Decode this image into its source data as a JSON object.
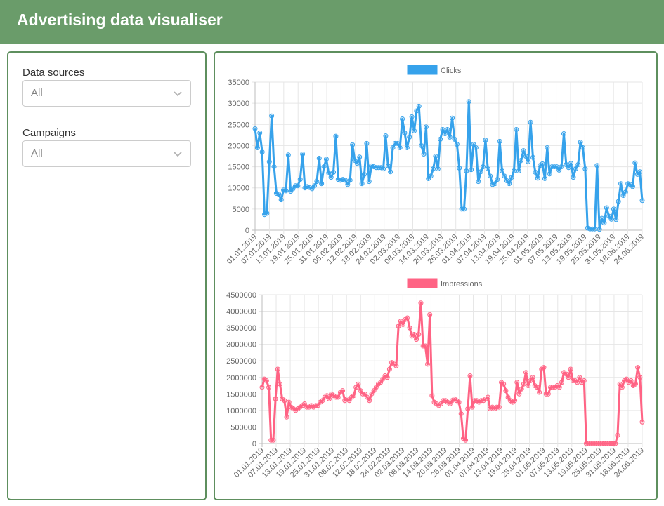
{
  "header": {
    "title": "Advertising data visualiser"
  },
  "filters": {
    "data_sources": {
      "label": "Data sources",
      "value": "All"
    },
    "campaigns": {
      "label": "Campaigns",
      "value": "All"
    }
  },
  "colors": {
    "header": "#6a9c6a",
    "clicks": "#36a2eb",
    "impressions": "#ff6384"
  },
  "chart_data": [
    {
      "type": "line",
      "series": [
        {
          "name": "Clicks",
          "color": "#36a2eb"
        }
      ],
      "xticks": [
        "01.01.2019",
        "07.01.2019",
        "13.01.2019",
        "19.01.2019",
        "25.01.2019",
        "31.01.2019",
        "06.02.2019",
        "12.02.2019",
        "18.02.2019",
        "24.02.2019",
        "02.03.2019",
        "08.03.2019",
        "14.03.2019",
        "20.03.2019",
        "26.03.2019",
        "01.04.2019",
        "07.04.2019",
        "13.04.2019",
        "19.04.2019",
        "25.04.2019",
        "01.05.2019",
        "07.05.2019",
        "13.05.2019",
        "19.05.2019",
        "25.05.2019",
        "31.05.2019",
        "18.06.2019",
        "24.06.2019"
      ],
      "yticks": [
        "0",
        "5000",
        "10000",
        "15000",
        "20000",
        "25000",
        "30000",
        "35000"
      ],
      "ylim": [
        0,
        35000
      ],
      "grid": true,
      "legend": "top",
      "values": [
        24000,
        19500,
        23000,
        18500,
        3700,
        4000,
        16200,
        27000,
        15000,
        8700,
        8500,
        7200,
        9500,
        9300,
        17800,
        9200,
        9800,
        10500,
        10500,
        12000,
        18000,
        10000,
        10300,
        10100,
        9800,
        10500,
        11500,
        17000,
        11000,
        15000,
        16800,
        13500,
        12500,
        13700,
        22200,
        12000,
        11800,
        12000,
        11800,
        10800,
        11800,
        20200,
        16500,
        15800,
        17300,
        11000,
        13200,
        20500,
        11500,
        15200,
        15000,
        14800,
        14800,
        14800,
        14500,
        22300,
        15200,
        13800,
        19500,
        20500,
        20500,
        19500,
        26300,
        23000,
        19500,
        22000,
        26800,
        23500,
        28200,
        29300,
        20000,
        18000,
        24400,
        12200,
        12800,
        14500,
        17500,
        14500,
        21500,
        23800,
        22800,
        23800,
        22000,
        26500,
        21500,
        20300,
        14700,
        5000,
        5000,
        14000,
        30400,
        14300,
        20300,
        19500,
        11500,
        13800,
        15000,
        21300,
        14500,
        12800,
        10800,
        11000,
        12000,
        21000,
        14000,
        12800,
        11700,
        11000,
        12500,
        14000,
        23800,
        14000,
        16500,
        18800,
        17500,
        16200,
        25500,
        17200,
        13700,
        12300,
        15300,
        15700,
        12200,
        19500,
        13300,
        15000,
        15000,
        15000,
        14200,
        15000,
        22800,
        15500,
        14800,
        15800,
        12500,
        14500,
        15500,
        20800,
        19500,
        14500,
        500,
        300,
        300,
        300,
        15300,
        200,
        2800,
        1700,
        5300,
        3300,
        2600,
        5000,
        2500,
        6800,
        11000,
        8200,
        9000,
        11000,
        10800,
        10300,
        15900,
        13200,
        13800,
        7000
      ]
    },
    {
      "type": "line",
      "series": [
        {
          "name": "Impressions",
          "color": "#ff6384"
        }
      ],
      "xticks": [
        "01.01.2019",
        "07.01.2019",
        "13.01.2019",
        "19.01.2019",
        "25.01.2019",
        "31.01.2019",
        "06.02.2019",
        "12.02.2019",
        "18.02.2019",
        "24.02.2019",
        "02.03.2019",
        "08.03.2019",
        "14.03.2019",
        "20.03.2019",
        "26.03.2019",
        "01.04.2019",
        "07.04.2019",
        "13.04.2019",
        "19.04.2019",
        "25.04.2019",
        "01.05.2019",
        "07.05.2019",
        "13.05.2019",
        "19.05.2019",
        "25.05.2019",
        "31.05.2019",
        "18.06.2019",
        "24.06.2019"
      ],
      "yticks": [
        "0",
        "500000",
        "1000000",
        "1500000",
        "2000000",
        "2500000",
        "3000000",
        "3500000",
        "4000000",
        "4500000"
      ],
      "ylim": [
        0,
        4500000
      ],
      "grid": true,
      "legend": "top",
      "values": [
        1700000,
        1950000,
        1900000,
        1700000,
        100000,
        100000,
        1350000,
        2250000,
        1800000,
        1350000,
        1300000,
        800000,
        1250000,
        1100000,
        1050000,
        1000000,
        1050000,
        1100000,
        1150000,
        1200000,
        1100000,
        1100000,
        1150000,
        1100000,
        1150000,
        1150000,
        1250000,
        1300000,
        1400000,
        1450000,
        1350000,
        1500000,
        1450000,
        1400000,
        1400000,
        1550000,
        1600000,
        1300000,
        1350000,
        1300000,
        1400000,
        1450000,
        1700000,
        1800000,
        1600000,
        1500000,
        1500000,
        1400000,
        1300000,
        1500000,
        1600000,
        1700000,
        1800000,
        1850000,
        1950000,
        2050000,
        2000000,
        2250000,
        2450000,
        2400000,
        2350000,
        3550000,
        3700000,
        3600000,
        3750000,
        3800000,
        3500000,
        3250000,
        3300000,
        3150000,
        3300000,
        4250000,
        2950000,
        2950000,
        2400000,
        3900000,
        1450000,
        1250000,
        1200000,
        1150000,
        1200000,
        1300000,
        1300000,
        1250000,
        1200000,
        1300000,
        1350000,
        1300000,
        1250000,
        900000,
        150000,
        100000,
        1050000,
        2050000,
        1100000,
        1300000,
        1300000,
        1250000,
        1300000,
        1300000,
        1350000,
        1400000,
        1050000,
        1100000,
        1050000,
        1100000,
        1100000,
        1850000,
        1800000,
        1600000,
        1400000,
        1300000,
        1250000,
        1300000,
        1850000,
        1500000,
        1650000,
        1800000,
        2150000,
        1750000,
        1900000,
        2000000,
        1750000,
        1700000,
        1550000,
        2250000,
        2300000,
        1500000,
        1500000,
        1700000,
        1700000,
        1700000,
        1750000,
        1700000,
        1850000,
        2150000,
        2100000,
        2000000,
        2250000,
        1900000,
        1900000,
        1850000,
        2000000,
        1850000,
        1900000,
        0,
        0,
        0,
        0,
        0,
        0,
        0,
        0,
        0,
        0,
        0,
        0,
        0,
        0,
        250000,
        1800000,
        1700000,
        1900000,
        1950000,
        1850000,
        1900000,
        1750000,
        1800000,
        2300000,
        2000000,
        650000
      ]
    }
  ]
}
